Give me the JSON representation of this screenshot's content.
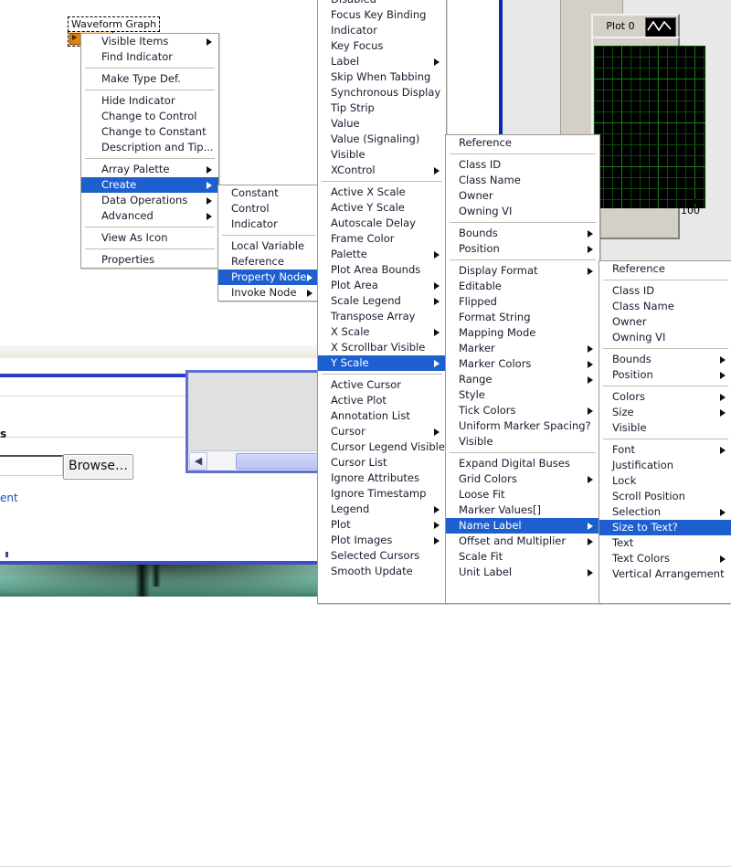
{
  "diagram": {
    "terminal_label": "Waveform Graph",
    "terminal_icon": "waveform-graph-terminal-icon"
  },
  "graph": {
    "legend_label": "Plot 0",
    "plot_preview_icon": "waveform-plot-icon",
    "y_axis_max_label": "100"
  },
  "lower_window": {
    "section_heading": "s",
    "text_field_value": "",
    "browse_button": "Browse…",
    "link_text": "ent"
  },
  "inner_panel": {
    "scroll_left_icon": "chevron-left-icon"
  },
  "menus": {
    "context_menu": {
      "name": "waveform-graph-context-menu",
      "items": [
        {
          "label": "Visible Items",
          "submenu": true
        },
        {
          "label": "Find Indicator"
        },
        {
          "separator": true
        },
        {
          "label": "Make Type Def."
        },
        {
          "separator": true
        },
        {
          "label": "Hide Indicator"
        },
        {
          "label": "Change to Control"
        },
        {
          "label": "Change to Constant"
        },
        {
          "label": "Description and Tip..."
        },
        {
          "separator": true
        },
        {
          "label": "Array Palette",
          "submenu": true
        },
        {
          "label": "Create",
          "submenu": true,
          "selected": true
        },
        {
          "label": "Data Operations",
          "submenu": true
        },
        {
          "label": "Advanced",
          "submenu": true
        },
        {
          "separator": true
        },
        {
          "label": "View As Icon"
        },
        {
          "separator": true
        },
        {
          "label": "Properties"
        }
      ]
    },
    "create_menu": {
      "name": "create-submenu",
      "items": [
        {
          "label": "Constant"
        },
        {
          "label": "Control"
        },
        {
          "label": "Indicator"
        },
        {
          "separator": true
        },
        {
          "label": "Local Variable"
        },
        {
          "label": "Reference"
        },
        {
          "label": "Property Node",
          "submenu": true,
          "selected": true
        },
        {
          "label": "Invoke Node",
          "submenu": true
        }
      ]
    },
    "property_node_menu": {
      "name": "property-node-submenu",
      "items": [
        {
          "label": "Disabled"
        },
        {
          "label": "Focus Key Binding"
        },
        {
          "label": "Indicator"
        },
        {
          "label": "Key Focus"
        },
        {
          "label": "Label",
          "submenu": true
        },
        {
          "label": "Skip When Tabbing"
        },
        {
          "label": "Synchronous Display"
        },
        {
          "label": "Tip Strip"
        },
        {
          "label": "Value"
        },
        {
          "label": "Value (Signaling)"
        },
        {
          "label": "Visible"
        },
        {
          "label": "XControl",
          "submenu": true
        },
        {
          "separator": true
        },
        {
          "label": "Active X Scale"
        },
        {
          "label": "Active Y Scale"
        },
        {
          "label": "Autoscale Delay"
        },
        {
          "label": "Frame Color"
        },
        {
          "label": "Palette",
          "submenu": true
        },
        {
          "label": "Plot Area Bounds"
        },
        {
          "label": "Plot Area",
          "submenu": true
        },
        {
          "label": "Scale Legend",
          "submenu": true
        },
        {
          "label": "Transpose Array"
        },
        {
          "label": "X Scale",
          "submenu": true
        },
        {
          "label": "X Scrollbar Visible"
        },
        {
          "label": "Y Scale",
          "submenu": true,
          "selected": true
        },
        {
          "separator": true
        },
        {
          "label": "Active Cursor"
        },
        {
          "label": "Active Plot"
        },
        {
          "label": "Annotation List"
        },
        {
          "label": "Cursor",
          "submenu": true
        },
        {
          "label": "Cursor Legend Visible"
        },
        {
          "label": "Cursor List"
        },
        {
          "label": "Ignore Attributes"
        },
        {
          "label": "Ignore Timestamp"
        },
        {
          "label": "Legend",
          "submenu": true
        },
        {
          "label": "Plot",
          "submenu": true
        },
        {
          "label": "Plot Images",
          "submenu": true
        },
        {
          "label": "Selected Cursors"
        },
        {
          "label": "Smooth Update"
        }
      ]
    },
    "y_scale_menu": {
      "name": "y-scale-submenu",
      "items": [
        {
          "label": "Reference"
        },
        {
          "separator": true
        },
        {
          "label": "Class ID"
        },
        {
          "label": "Class Name"
        },
        {
          "label": "Owner"
        },
        {
          "label": "Owning VI"
        },
        {
          "separator": true
        },
        {
          "label": "Bounds",
          "submenu": true
        },
        {
          "label": "Position",
          "submenu": true
        },
        {
          "separator": true
        },
        {
          "label": "Display Format",
          "submenu": true
        },
        {
          "label": "Editable"
        },
        {
          "label": "Flipped"
        },
        {
          "label": "Format String"
        },
        {
          "label": "Mapping Mode"
        },
        {
          "label": "Marker",
          "submenu": true
        },
        {
          "label": "Marker Colors",
          "submenu": true
        },
        {
          "label": "Range",
          "submenu": true
        },
        {
          "label": "Style"
        },
        {
          "label": "Tick Colors",
          "submenu": true
        },
        {
          "label": "Uniform Marker Spacing?"
        },
        {
          "label": "Visible"
        },
        {
          "separator": true
        },
        {
          "label": "Expand Digital Buses"
        },
        {
          "label": "Grid Colors",
          "submenu": true
        },
        {
          "label": "Loose Fit"
        },
        {
          "label": "Marker Values[]"
        },
        {
          "label": "Name Label",
          "submenu": true,
          "selected": true
        },
        {
          "label": "Offset and Multiplier",
          "submenu": true
        },
        {
          "label": "Scale Fit"
        },
        {
          "label": "Unit Label",
          "submenu": true
        }
      ]
    },
    "name_label_menu": {
      "name": "name-label-submenu",
      "items": [
        {
          "label": "Reference"
        },
        {
          "separator": true
        },
        {
          "label": "Class ID"
        },
        {
          "label": "Class Name"
        },
        {
          "label": "Owner"
        },
        {
          "label": "Owning VI"
        },
        {
          "separator": true
        },
        {
          "label": "Bounds",
          "submenu": true
        },
        {
          "label": "Position",
          "submenu": true
        },
        {
          "separator": true
        },
        {
          "label": "Colors",
          "submenu": true
        },
        {
          "label": "Size",
          "submenu": true
        },
        {
          "label": "Visible"
        },
        {
          "separator": true
        },
        {
          "label": "Font",
          "submenu": true
        },
        {
          "label": "Justification"
        },
        {
          "label": "Lock"
        },
        {
          "label": "Scroll Position"
        },
        {
          "label": "Selection",
          "submenu": true
        },
        {
          "label": "Size to Text?",
          "selected": true
        },
        {
          "label": "Text"
        },
        {
          "label": "Text Colors",
          "submenu": true
        },
        {
          "label": "Vertical Arrangement"
        }
      ]
    }
  },
  "colors": {
    "menu_highlight": "#1e5fd0",
    "menu_bg": "#ffffff",
    "panel_gray": "#d4d0c8",
    "plot_bg": "#000000",
    "grid_green": "#1d7d1d",
    "terminal_orange": "#e08214"
  }
}
